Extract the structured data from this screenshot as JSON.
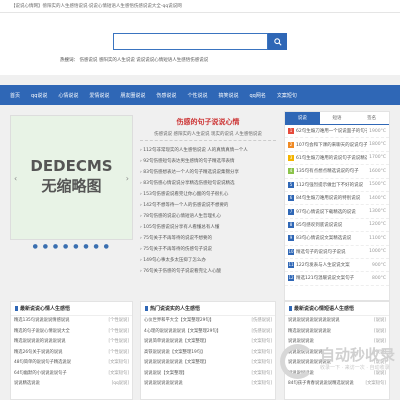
{
  "topbar": "【说说心情网】傍阳实的人生感悟说说·说说心情短语人生感悟伤感说说大全-qq说说网",
  "search": {
    "placeholder": ""
  },
  "hotwords": {
    "label": "热搜词：",
    "text": "伤感说说  感阳实的人生说说 说说说说心情短语人生感悟伤感说说"
  },
  "nav": [
    "首页",
    "qq说说",
    "心情说说",
    "爱情说说",
    "朋友圈说说",
    "伤感说说",
    "个性说说",
    "搞笑说说",
    "qq网名",
    "文案短句"
  ],
  "banner": {
    "line1": "DEDECMS",
    "line2": "无缩略图",
    "left_arrow": "‹",
    "right_arrow": "›",
    "dots": "● ● ● ● ● ● ● ●"
  },
  "middle": {
    "title": "伤感的句子说说心情",
    "sub": "伤感说说  感阳实的人生说说 现实的说说 人生感悟说说",
    "items": [
      "› 112句非常现实的人生感悟说说 人的真情真情一个人",
      "› 92句伤感短句表达男生感情的句子精选带表情",
      "› 83句伤感想表达一个人的句子精选说说集锦分享",
      "› 83句伤感心情说说分享精选伤感短句说说精选",
      "› 153句伤感说说看完让你心酸的句子很扎心",
      "› 142句不想等待一个人的伤感说说不想要的",
      "› 78句伤感的说说心情短语人生哲理扎心",
      "› 105句伤感说说分享有人看懂总有人懂",
      "› 75句关于不再等待的说说不想要的",
      "› 75句关于不再等待的伤感句子说说",
      "› 149句心事太多太压抑了怎么办",
      "› 76句关于伤感的句子说说看完让人心酸"
    ]
  },
  "right": {
    "tabs": [
      "说说",
      "短语",
      "签名"
    ],
    "items": [
      {
        "n": "1",
        "t": "62句生煽刀难用一个说说面子的句子",
        "d": "1900°C",
        "c": "#e64a3b"
      },
      {
        "n": "2",
        "t": "107句会和下课的来聊天的说说句子",
        "d": "1800°C",
        "c": "#f08a24"
      },
      {
        "n": "3",
        "t": "61句生煽刀难用的说说句子说说精选",
        "d": "1700°C",
        "c": "#f4b400"
      },
      {
        "n": "4",
        "t": "135句有点想点精选说说的句子",
        "d": "1600°C",
        "c": "#8bc34a"
      },
      {
        "n": "5",
        "t": "112句强烈提示做出下不好的说说",
        "d": "1500°C",
        "c": "#2f67b6"
      },
      {
        "n": "6",
        "t": "84句生煽刀难用说说的特别说说",
        "d": "1400°C",
        "c": "#2f67b6"
      },
      {
        "n": "7",
        "t": "97句心情说说下载精选的说说",
        "d": "1300°C",
        "c": "#2f67b6"
      },
      {
        "n": "8",
        "t": "85句感叹到底说说说说",
        "d": "1200°C",
        "c": "#2f67b6"
      },
      {
        "n": "9",
        "t": "83句心情说说文案精选说说",
        "d": "1100°C",
        "c": "#2f67b6"
      },
      {
        "n": "10",
        "t": "精选句子的说说句子说说",
        "d": "1000°C",
        "c": "#2f67b6"
      },
      {
        "n": "11",
        "t": "122句发表与人生说说文案",
        "d": "900°C",
        "c": "#2f67b6"
      },
      {
        "n": "12",
        "t": "精选121句温暖说说文案句子",
        "d": "800°C",
        "c": "#2f67b6"
      }
    ]
  },
  "bottom": [
    {
      "title": "最新说说心情人生感悟",
      "items": [
        {
          "t": "精选135句说说说说情感说说",
          "c": "[个性说说]"
        },
        {
          "t": "精选的句子说说心情说说大全",
          "c": "[个性说说]"
        },
        {
          "t": "精选说说说说的说说说说说",
          "c": "[个性说说]"
        },
        {
          "t": "精选26句关于说说的说说",
          "c": "[个性说说]"
        },
        {
          "t": "48句简单的说说句子精选说说",
          "c": "[文案短句]"
        },
        {
          "t": "64句幽默的小说说说说句子",
          "c": "[文案短句]"
        },
        {
          "t": "说说精选说说",
          "c": "[qq说说]"
        }
      ]
    },
    {
      "title": "热门说说实的人生感悟",
      "items": [
        {
          "t": "心仪世界和平大全【文案整理29句】",
          "c": "[伤感说说]"
        },
        {
          "t": "4心理的说说说说说说【文案整理29句】",
          "c": "[伤感说说]"
        },
        {
          "t": "说说简单说说说说说【文案整理】",
          "c": "[文案短句]"
        },
        {
          "t": "高铁说说说说【文案整理19句】",
          "c": "[文案短句]"
        },
        {
          "t": "说说说说说说说说说【文案整理】",
          "c": "[文案短句]"
        },
        {
          "t": "说说说说【文案整理】",
          "c": "[文案短句]"
        },
        {
          "t": "说说说说说说说说说",
          "c": "[文案短句]"
        }
      ]
    },
    {
      "title": "最新说说心情短语人生感悟",
      "items": [
        {
          "t": "说说说说说说说说说说说说",
          "c": "[说说]"
        },
        {
          "t": "精选说说说说说说说说",
          "c": "[说说]"
        },
        {
          "t": "说说说说说说",
          "c": "[说说]"
        },
        {
          "t": "说说说说说说说说",
          "c": "[说说]"
        },
        {
          "t": "说说说说说说说说说说",
          "c": "[说说]"
        },
        {
          "t": "说说说说说说",
          "c": "[说说]"
        },
        {
          "t": "84句孩子青春说说说说精选说说说",
          "c": "[文案短句]"
        }
      ]
    }
  ],
  "watermark": {
    "big": "自动秒收录",
    "small": "收录一下 · 来访一次 · 自动收录"
  }
}
